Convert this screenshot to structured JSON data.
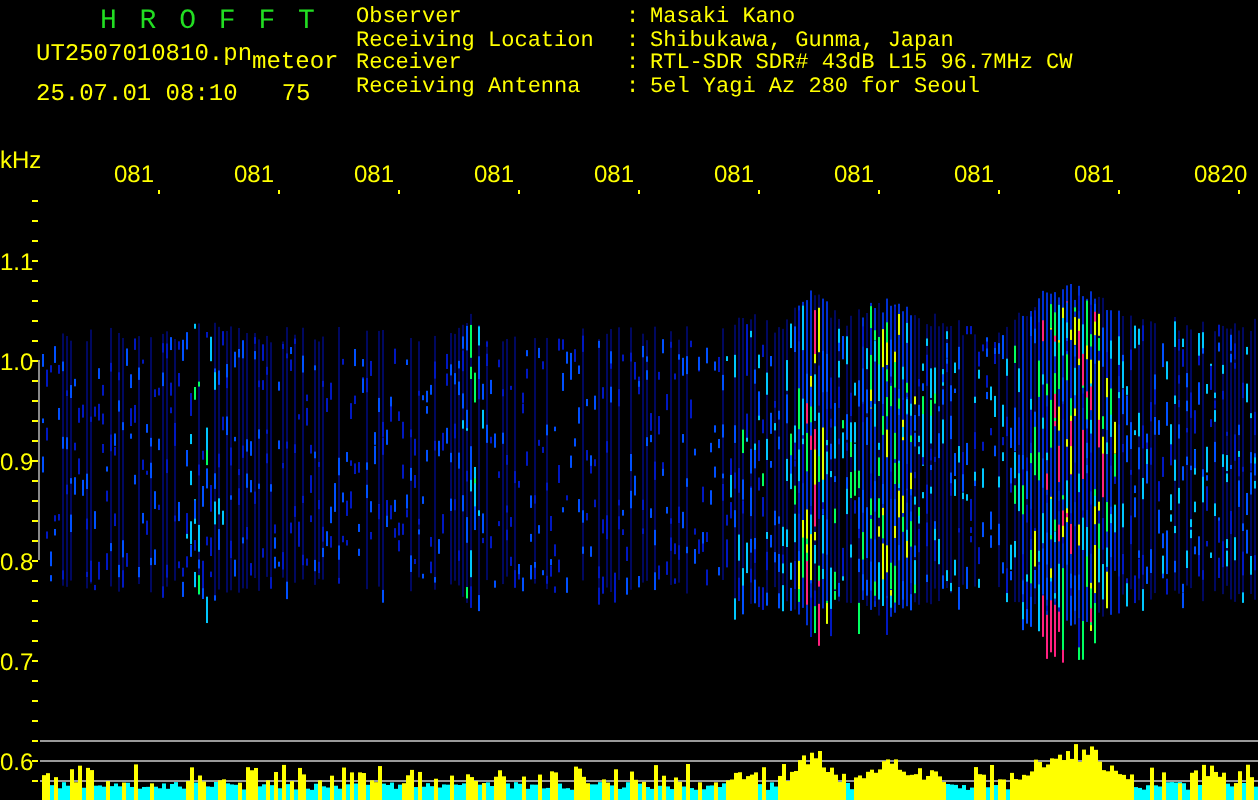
{
  "header": {
    "title": "H R O F F T",
    "file_name": "UT2507010810.pn",
    "mode": "meteor",
    "timestamp": "25.07.01 08:10",
    "count": "75"
  },
  "station_info": [
    {
      "label": "Observer",
      "separator": ":",
      "value": "Masaki Kano"
    },
    {
      "label": "Receiving Location",
      "separator": ":",
      "value": "Shibukawa, Gunma, Japan"
    },
    {
      "label": "Receiver",
      "separator": ":",
      "value": "RTL-SDR SDR# 43dB L15 96.7MHz CW"
    },
    {
      "label": "Receiving Antenna",
      "separator": ":",
      "value": "5el Yagi Az 280 for Seoul"
    }
  ],
  "plot": {
    "frequency_unit": "kHz",
    "time_labels": [
      "081",
      "081",
      "081",
      "081",
      "081",
      "081",
      "081",
      "081",
      "081",
      "0820"
    ],
    "frequency_labels": [
      "1.1",
      "1.0",
      "0.9",
      "0.8",
      "0.7",
      "0.6"
    ]
  }
}
